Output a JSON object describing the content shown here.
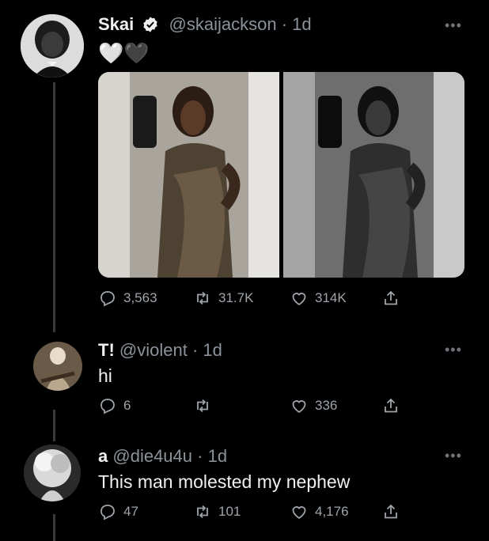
{
  "tweets": [
    {
      "name": "Skai",
      "handle": "@skaijackson",
      "time": "· 1d",
      "text": "🤍🖤",
      "stats": {
        "replies": "3,563",
        "retweets": "31.7K",
        "likes": "314K"
      },
      "media": [
        {
          "alt": "photo-color"
        },
        {
          "alt": "photo-bw"
        }
      ]
    },
    {
      "name": "T!",
      "handle": "@violent",
      "time": "· 1d",
      "text": "hi",
      "stats": {
        "replies": "6",
        "retweets": "",
        "likes": "336"
      }
    },
    {
      "name": "a",
      "handle": "@die4u4u",
      "time": "· 1d",
      "text": "This man molested my nephew",
      "stats": {
        "replies": "47",
        "retweets": "101",
        "likes": "4,176"
      }
    }
  ],
  "icons": {
    "reply": "reply-icon",
    "retweet": "retweet-icon",
    "like": "heart-icon",
    "share": "share-icon",
    "more": "more-icon",
    "verified": "verified-badge-icon"
  },
  "colors": {
    "background": "#000000",
    "muted": "#9ea4aa",
    "text": "#e7e9ea"
  }
}
